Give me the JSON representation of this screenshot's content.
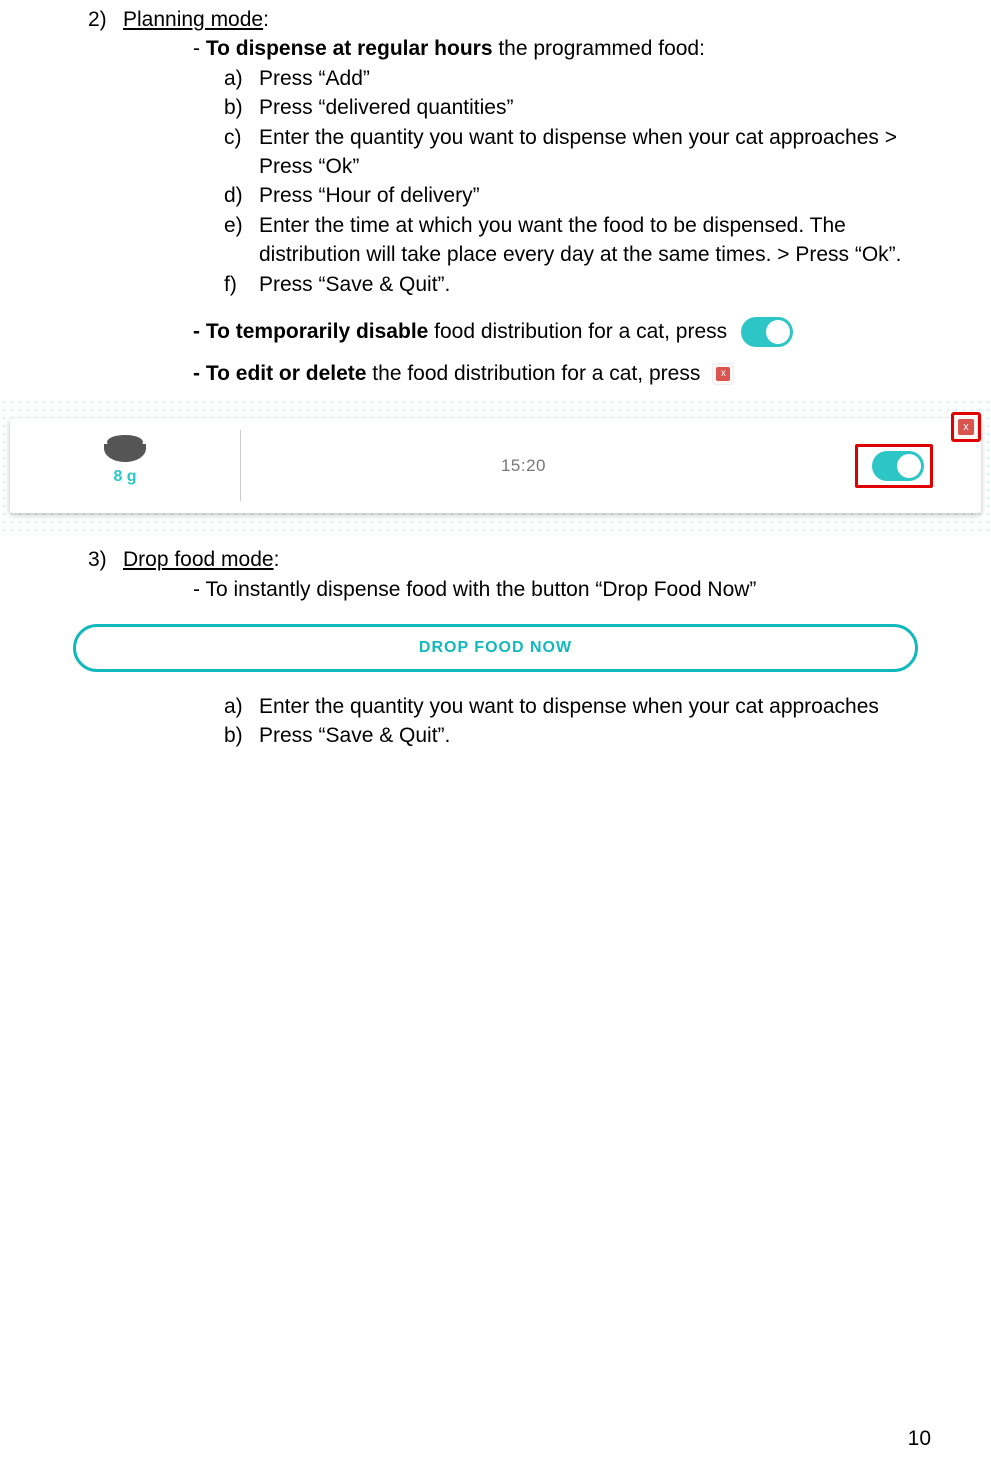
{
  "section2": {
    "number": "2)",
    "title": "Planning mode",
    "intro_dash": "- ",
    "intro_bold": "To dispense at regular hours",
    "intro_rest": " the programmed food:",
    "steps": [
      {
        "l": "a)",
        "t": "Press “Add”"
      },
      {
        "l": "b)",
        "t": "Press “delivered quantities”"
      },
      {
        "l": "c)",
        "t": "Enter the quantity you want to dispense when your cat approaches > Press “Ok”"
      },
      {
        "l": "d)",
        "t": "Press “Hour of delivery”"
      },
      {
        "l": "e)",
        "t": "Enter the time at which you want the food to be dispensed. The distribution will take place every day at the same times. > Press “Ok”."
      },
      {
        "l": "f)",
        "t": "Press “Save & Quit”."
      }
    ],
    "disable_lead": "- To temporarily disable",
    "disable_rest": " food distribution for a cat, press",
    "edit_lead": "- To edit or delete",
    "edit_rest": " the food distribution for a cat, press"
  },
  "card": {
    "grams": "8 g",
    "time": "15:20",
    "delete_x": "x",
    "corner_x": "x"
  },
  "section3": {
    "number": "3)",
    "title": "Drop food mode",
    "intro": "- To instantly dispense food with the button “Drop Food Now”",
    "button_label": "DROP FOOD NOW",
    "steps": [
      {
        "l": "a)",
        "t": "Enter the quantity you want to dispense when your cat approaches"
      },
      {
        "l": "b)",
        "t": "Press “Save & Quit”."
      }
    ]
  },
  "inline_x": "x",
  "page_number": "10"
}
